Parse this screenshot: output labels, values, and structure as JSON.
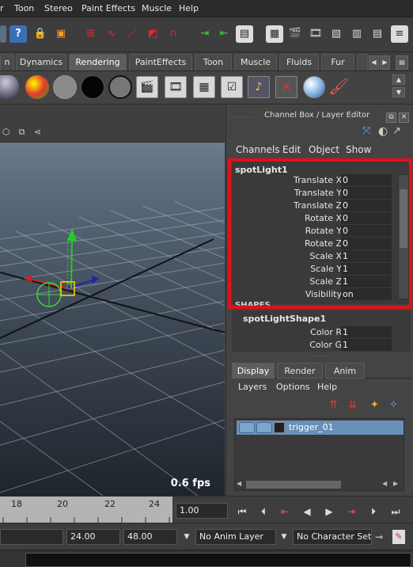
{
  "menubar": [
    "r",
    "Toon",
    "Stereo",
    "Paint Effects",
    "Muscle",
    "Help"
  ],
  "statusline": {
    "help_icon": "?",
    "icons": [
      "lock-icon",
      "select-by-hierarchy-icon",
      "snap-grid-icon",
      "snap-curve-icon",
      "snap-point-icon",
      "snap-view-plane-icon",
      "make-live-icon",
      "input-ops-icon",
      "output-ops-icon",
      "construction-history-icon",
      "render-frame-icon",
      "render-view-icon",
      "ipr-render-icon",
      "render-settings-icon",
      "hypershade-icon",
      "toggle-attribute-editor-icon"
    ]
  },
  "shelf_tabs": {
    "items": [
      "n",
      "Dynamics",
      "Rendering",
      "PaintEffects",
      "Toon",
      "Muscle",
      "Fluids",
      "Fur"
    ],
    "active": "Rendering"
  },
  "shelf": {
    "colors": {
      "ball1": "#6a7fa8",
      "ball2": "#e03b2a",
      "ball3": "#8a8a8a",
      "ball4": "#050505",
      "ball5": "#777777"
    }
  },
  "viewport": {
    "fps": "0.6 fps",
    "toolbar_icons": [
      "cube-icon",
      "frame-icon",
      "share-icon"
    ]
  },
  "channel_box": {
    "title": "Channel Box / Layer Editor",
    "menu": [
      "Channels",
      "Edit",
      "Object",
      "Show"
    ],
    "node": "spotLight1",
    "channels": [
      {
        "label": "Translate X",
        "value": "0"
      },
      {
        "label": "Translate Y",
        "value": "0"
      },
      {
        "label": "Translate Z",
        "value": "0"
      },
      {
        "label": "Rotate X",
        "value": "0"
      },
      {
        "label": "Rotate Y",
        "value": "0"
      },
      {
        "label": "Rotate Z",
        "value": "0"
      },
      {
        "label": "Scale X",
        "value": "1"
      },
      {
        "label": "Scale Y",
        "value": "1"
      },
      {
        "label": "Scale Z",
        "value": "1"
      },
      {
        "label": "Visibility",
        "value": "on"
      }
    ],
    "shapes_header": "SHAPES",
    "shape_node": "spotLightShape1",
    "shape_channels": [
      {
        "label": "Color R",
        "value": "1"
      },
      {
        "label": "Color G",
        "value": "1"
      }
    ]
  },
  "layer_editor": {
    "tabs": [
      "Display",
      "Render",
      "Anim"
    ],
    "active_tab": "Display",
    "menu": [
      "Layers",
      "Options",
      "Help"
    ],
    "layers": [
      {
        "name": "trigger_01"
      }
    ]
  },
  "time_slider": {
    "ticks": [
      "18",
      "20",
      "22",
      "24"
    ],
    "current_time": "1.00"
  },
  "range_slider": {
    "start": "24.00",
    "end": "48.00",
    "anim_layer": "No Anim Layer",
    "character_set": "No Character Set"
  },
  "colors": {
    "highlight_box": "#e1101b",
    "layer_selected": "#6890b8"
  }
}
